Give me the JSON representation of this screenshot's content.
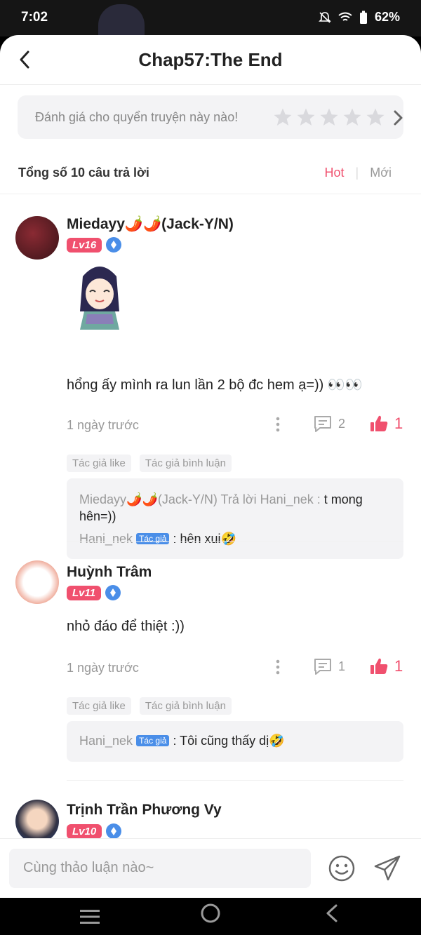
{
  "status": {
    "time": "7:02",
    "battery": "62%"
  },
  "header": {
    "title": "Chap57:The End"
  },
  "rating": {
    "prompt": "Đánh giá cho quyển truyện này nào!"
  },
  "summary": {
    "total": "Tổng số 10 câu trả lời",
    "sort_hot": "Hot",
    "sort_new": "Mới"
  },
  "comments": [
    {
      "username": "Miedayy🌶️🌶️(Jack-Y/N)",
      "level": "Lv16",
      "text": "hổng ấy mình ra lun lần 2 bộ đc hem ạ=)) 👀👀",
      "time": "1 ngày trước",
      "reply_count": "2",
      "like_count": "1",
      "tag1": "Tác giả like",
      "tag2": "Tác giả bình luận",
      "replies": [
        {
          "prefix": "Miedayy🌶️🌶️(Jack-Y/N) Trả lời Hani_nek : ",
          "content": "t mong hên=))"
        },
        {
          "name": "Hani_nek",
          "badge": "Tác giả",
          "content": " : hên xui🤣"
        }
      ]
    },
    {
      "username": "Huỳnh Trâm",
      "level": "Lv11",
      "text": "nhỏ đáo để thiệt :))",
      "time": "1 ngày trước",
      "reply_count": "1",
      "like_count": "1",
      "tag1": "Tác giả like",
      "tag2": "Tác giả bình luận",
      "replies": [
        {
          "name": "Hani_nek",
          "badge": "Tác giả",
          "content": " : Tôi cũng thấy dị🤣"
        }
      ]
    },
    {
      "username": "Trịnh Trần Phương Vy",
      "level": "Lv10"
    }
  ],
  "composer": {
    "placeholder": "Cùng thảo luận nào~"
  },
  "colors": {
    "accent": "#f0506e",
    "verify": "#4a8ee8"
  },
  "icons": [
    "back-icon",
    "star-icon",
    "chevron-right-icon",
    "more-icon",
    "comment-icon",
    "thumb-up-icon",
    "emoji-icon",
    "send-icon"
  ]
}
